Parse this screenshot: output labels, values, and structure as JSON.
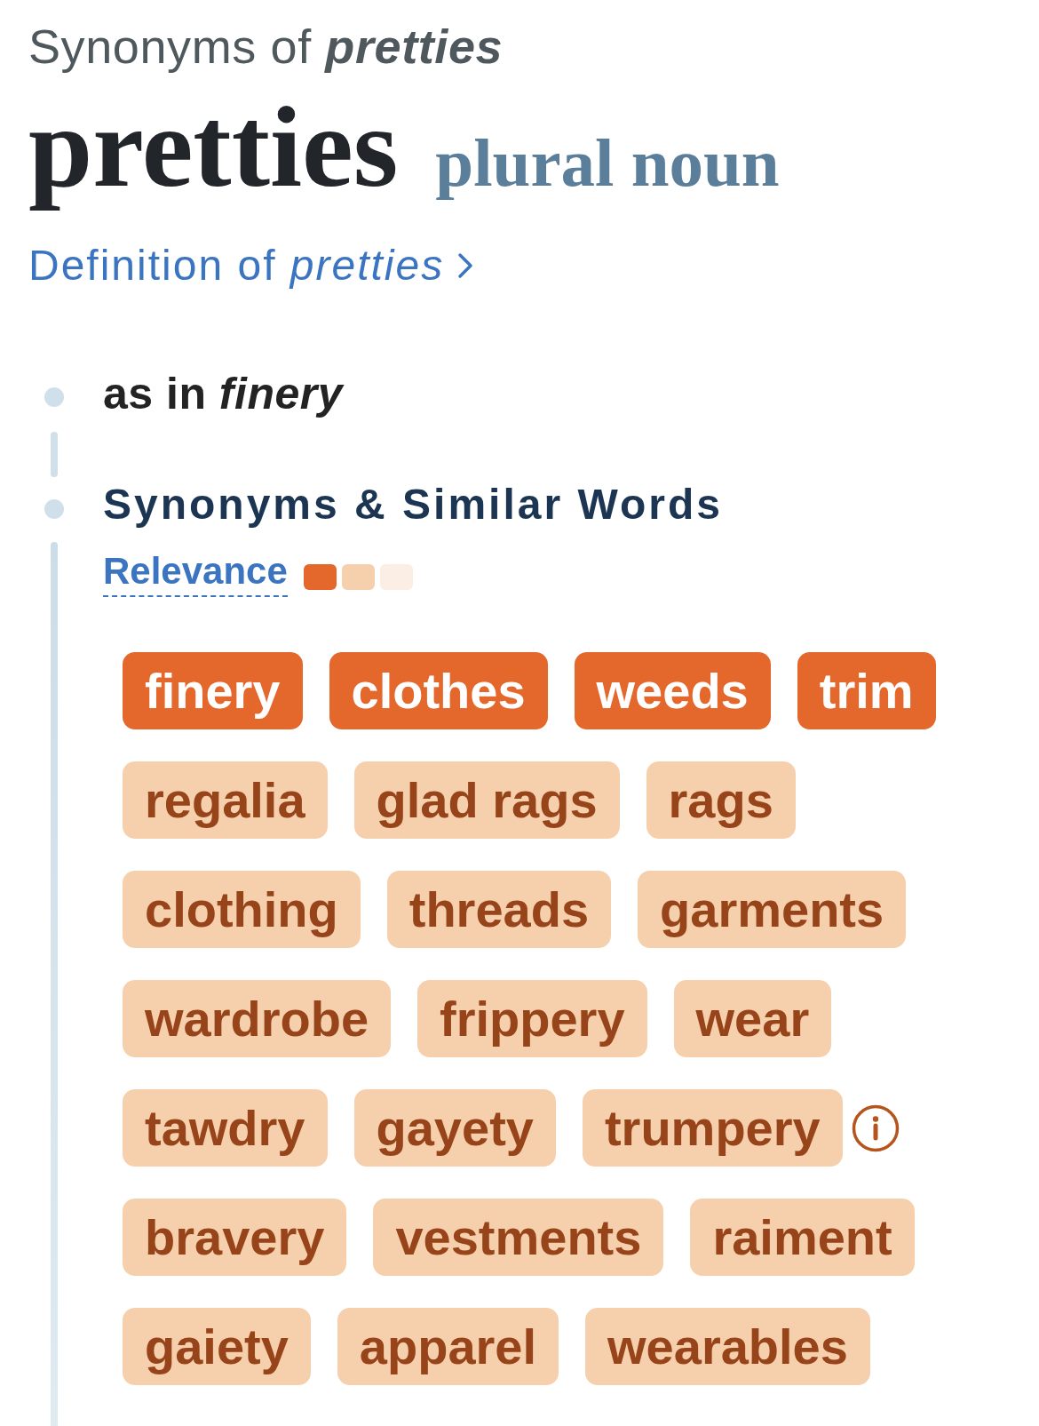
{
  "page_heading": {
    "prefix": "Synonyms of",
    "word": "pretties"
  },
  "entry": {
    "headword": "pretties",
    "part_of_speech": "plural noun"
  },
  "definition_link": "Definition of *pretties*",
  "sense": {
    "label": "as in *finery*",
    "section_title": "Synonyms & Similar Words",
    "relevance_label": "Relevance",
    "relevance_scale": [
      {
        "color": "#e4672c"
      },
      {
        "color": "#f6d0ad"
      },
      {
        "color": "#fbeee5"
      }
    ],
    "synonyms": [
      {
        "word": "finery",
        "kind": "strong",
        "info": false
      },
      {
        "word": "clothes",
        "kind": "strong",
        "info": false
      },
      {
        "word": "weeds",
        "kind": "strong",
        "info": false
      },
      {
        "word": "trim",
        "kind": "strong",
        "info": false
      },
      {
        "word": "regalia",
        "kind": "related",
        "info": false
      },
      {
        "word": "glad rags",
        "kind": "related",
        "info": false
      },
      {
        "word": "rags",
        "kind": "related",
        "info": false
      },
      {
        "word": "clothing",
        "kind": "related",
        "info": false
      },
      {
        "word": "threads",
        "kind": "related",
        "info": false
      },
      {
        "word": "garments",
        "kind": "related",
        "info": false
      },
      {
        "word": "wardrobe",
        "kind": "related",
        "info": false
      },
      {
        "word": "frippery",
        "kind": "related",
        "info": false
      },
      {
        "word": "wear",
        "kind": "related",
        "info": false
      },
      {
        "word": "tawdry",
        "kind": "related",
        "info": false
      },
      {
        "word": "gayety",
        "kind": "related",
        "info": false
      },
      {
        "word": "trumpery",
        "kind": "related",
        "info": true
      },
      {
        "word": "bravery",
        "kind": "related",
        "info": false
      },
      {
        "word": "vestments",
        "kind": "related",
        "info": false
      },
      {
        "word": "raiment",
        "kind": "related",
        "info": false
      },
      {
        "word": "gaiety",
        "kind": "related",
        "info": false
      },
      {
        "word": "apparel",
        "kind": "related",
        "info": false
      },
      {
        "word": "wearables",
        "kind": "related",
        "info": false
      }
    ]
  }
}
